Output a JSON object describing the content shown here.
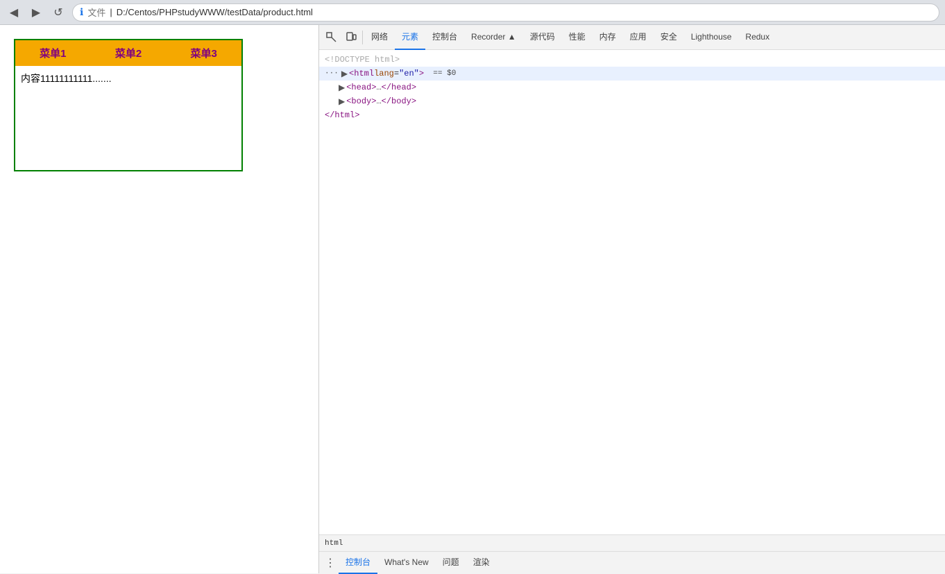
{
  "browser": {
    "back_label": "◀",
    "forward_label": "▶",
    "reload_label": "↺",
    "info_icon": "ℹ",
    "file_label": "文件",
    "url": "D:/Centos/PHPstudyWWW/testData/product.html",
    "separator": "|"
  },
  "webpage": {
    "menu_items": [
      "菜单1",
      "菜单2",
      "菜单3"
    ],
    "content": "内容11111111111......."
  },
  "devtools": {
    "icons": {
      "inspect": "⬚",
      "device": "☐"
    },
    "tabs": [
      {
        "id": "network",
        "label": "网络",
        "active": false
      },
      {
        "id": "elements",
        "label": "元素",
        "active": true
      },
      {
        "id": "console",
        "label": "控制台",
        "active": false
      },
      {
        "id": "recorder",
        "label": "Recorder ▲",
        "active": false
      },
      {
        "id": "sources",
        "label": "源代码",
        "active": false
      },
      {
        "id": "performance",
        "label": "性能",
        "active": false
      },
      {
        "id": "memory",
        "label": "内存",
        "active": false
      },
      {
        "id": "application",
        "label": "应用",
        "active": false
      },
      {
        "id": "security",
        "label": "安全",
        "active": false
      },
      {
        "id": "lighthouse",
        "label": "Lighthouse",
        "active": false
      },
      {
        "id": "redux",
        "label": "Redux",
        "active": false
      }
    ],
    "html_tree": [
      {
        "id": "doctype",
        "indent": 0,
        "content": "<!DOCTYPE html>",
        "type": "comment",
        "has_arrow": false
      },
      {
        "id": "html-tag",
        "indent": 0,
        "content": "",
        "type": "selected",
        "has_arrow": true,
        "selected": true
      },
      {
        "id": "head-tag",
        "indent": 1,
        "content": "",
        "type": "normal",
        "has_arrow": true
      },
      {
        "id": "body-tag",
        "indent": 1,
        "content": "",
        "type": "normal",
        "has_arrow": true
      },
      {
        "id": "html-close",
        "indent": 0,
        "content": "</html>",
        "type": "normal",
        "has_arrow": false
      }
    ],
    "html_line_selected": "<html lang=\"en\">  == $0",
    "html_tag_open": "<html",
    "html_attr_name": "lang",
    "html_attr_value": "\"en\"",
    "html_tag_close": ">",
    "html_eq": " == $0",
    "head_content": "<head>…</head>",
    "body_content": "<body>…</body>",
    "html_close": "</html>",
    "doctype_text": "<!DOCTYPE html>",
    "statusbar_text": "html",
    "bottom_dots": "⋮",
    "bottom_tabs": [
      {
        "id": "console-bottom",
        "label": "控制台",
        "active": true
      },
      {
        "id": "whatsnew",
        "label": "What's New",
        "active": false
      },
      {
        "id": "issues",
        "label": "问题",
        "active": false
      },
      {
        "id": "rendering",
        "label": "渲染",
        "active": false
      }
    ]
  }
}
